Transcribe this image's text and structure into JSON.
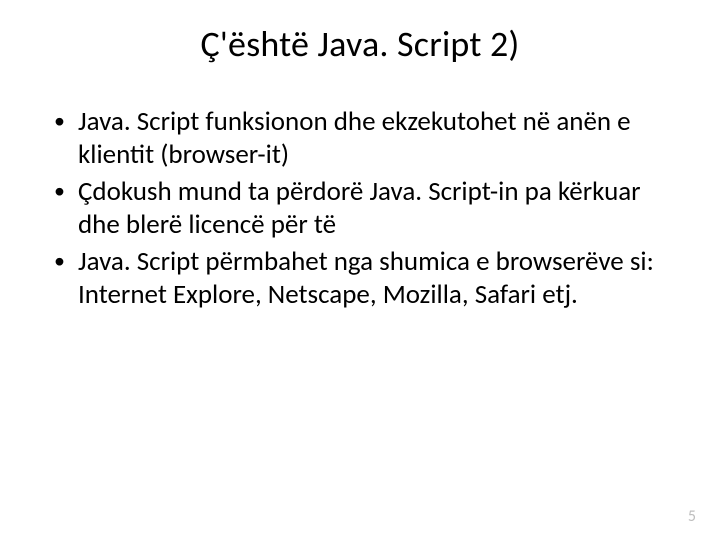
{
  "slide": {
    "title": "Ç'është Java. Script 2)",
    "bullets": [
      "Java. Script funksionon dhe ekzekutohet në anën e klientit (browser-it)",
      " Çdokush mund ta përdorë Java. Script-in pa kërkuar dhe blerë licencë për të",
      "Java. Script përmbahet nga shumica e browserëve si: Internet Explore, Netscape, Mozilla, Safari etj."
    ],
    "page_number": "5"
  }
}
